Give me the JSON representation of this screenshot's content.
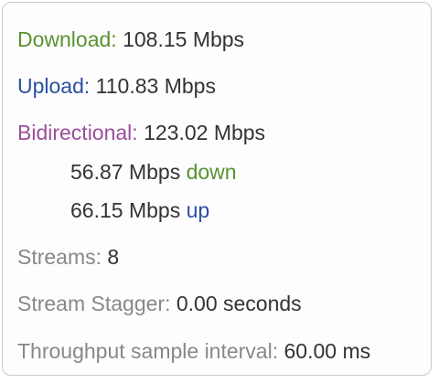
{
  "download": {
    "label": "Download:",
    "value": "108.15 Mbps"
  },
  "upload": {
    "label": "Upload:",
    "value": "110.83 Mbps"
  },
  "bidirectional": {
    "label": "Bidirectional:",
    "value": "123.02 Mbps",
    "down_value": "56.87 Mbps",
    "down_word": "down",
    "up_value": "66.15 Mbps",
    "up_word": "up"
  },
  "streams": {
    "label": "Streams:",
    "value": "8"
  },
  "stream_stagger": {
    "label": "Stream Stagger:",
    "value": "0.00 seconds"
  },
  "sample_interval": {
    "label": "Throughput sample interval:",
    "value": "60.00 ms"
  },
  "colors": {
    "download": "#5a9130",
    "upload": "#2b4fa0",
    "bidirectional": "#9a4f9a",
    "secondary_label": "#888888",
    "value_text": "#333333"
  }
}
